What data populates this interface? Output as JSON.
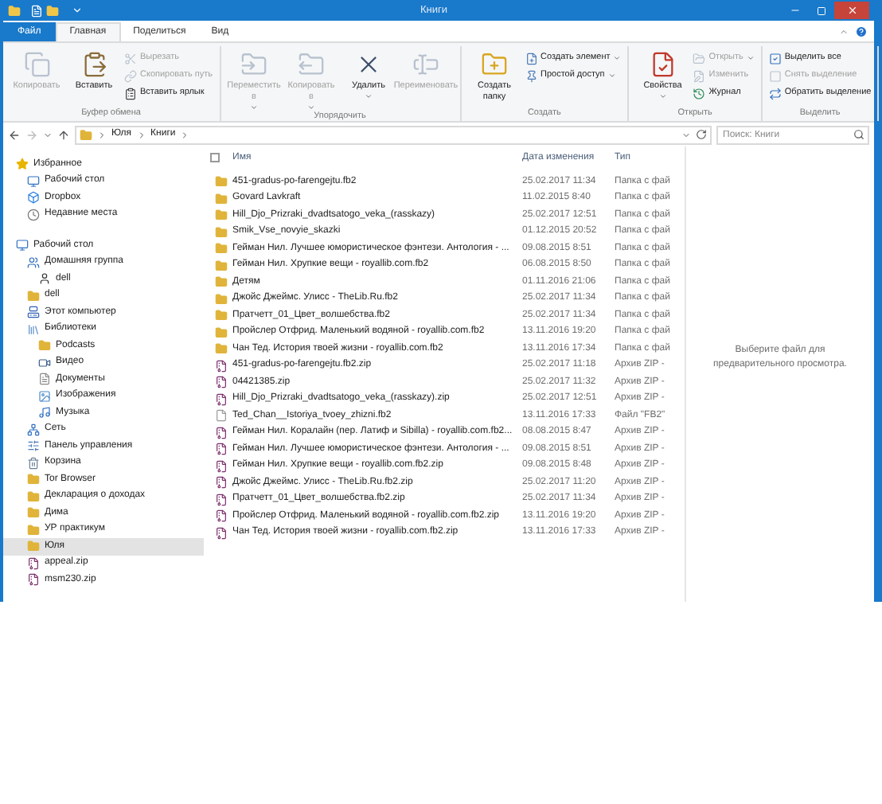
{
  "window": {
    "title": "Книги"
  },
  "tabs": [
    {
      "label": "Файл",
      "kind": "file",
      "selected": false
    },
    {
      "label": "Главная",
      "kind": "tab",
      "selected": true
    },
    {
      "label": "Поделиться",
      "kind": "tab",
      "selected": false
    },
    {
      "label": "Вид",
      "kind": "tab",
      "selected": false
    }
  ],
  "ribbon": [
    {
      "name": "Буфер обмена",
      "items": [
        {
          "label": "Копировать",
          "kind": "large",
          "disabled": true
        },
        {
          "label": "Вставить",
          "kind": "large",
          "disabled": false
        },
        {
          "label": "Вырезать",
          "kind": "small",
          "disabled": true
        },
        {
          "label": "Скопировать путь",
          "kind": "small",
          "disabled": true
        },
        {
          "label": "Вставить ярлык",
          "kind": "small",
          "disabled": false
        }
      ]
    },
    {
      "name": "Упорядочить",
      "items": [
        {
          "label": "Переместить в",
          "kind": "large",
          "disabled": true,
          "dropdown": true
        },
        {
          "label": "Копировать в",
          "kind": "large",
          "disabled": true,
          "dropdown": true
        },
        {
          "label": "Удалить",
          "kind": "large",
          "disabled": false,
          "dropdown": true
        },
        {
          "label": "Переименовать",
          "kind": "large",
          "disabled": true
        }
      ]
    },
    {
      "name": "Создать",
      "items": [
        {
          "label": "Создать папку",
          "kind": "large",
          "disabled": false
        },
        {
          "label": "Создать элемент",
          "kind": "small",
          "disabled": false,
          "dropdown": true
        },
        {
          "label": "Простой доступ",
          "kind": "small",
          "disabled": false,
          "dropdown": true
        }
      ]
    },
    {
      "name": "Открыть",
      "items": [
        {
          "label": "Свойства",
          "kind": "large",
          "disabled": false,
          "dropdown": true
        },
        {
          "label": "Открыть",
          "kind": "small",
          "disabled": true,
          "dropdown": true
        },
        {
          "label": "Изменить",
          "kind": "small",
          "disabled": true
        },
        {
          "label": "Журнал",
          "kind": "small",
          "disabled": false
        }
      ]
    },
    {
      "name": "Выделить",
      "items": [
        {
          "label": "Выделить все",
          "kind": "small",
          "disabled": false
        },
        {
          "label": "Снять выделение",
          "kind": "small",
          "disabled": true
        },
        {
          "label": "Обратить выделение",
          "kind": "small",
          "disabled": false
        }
      ]
    }
  ],
  "address": {
    "path": [
      "Юля",
      "Книги"
    ],
    "search_placeholder": "Поиск: Книги"
  },
  "sidebar": [
    {
      "items": [
        {
          "label": "Избранное",
          "selected": false,
          "children": [
            {
              "label": "Рабочий стол",
              "selected": false
            },
            {
              "label": "Dropbox",
              "selected": false
            },
            {
              "label": "Недавние места",
              "selected": false
            }
          ]
        }
      ]
    },
    {
      "items": [
        {
          "label": "Рабочий стол",
          "selected": false,
          "children": [
            {
              "label": "Домашняя группа",
              "selected": false,
              "children": [
                {
                  "label": "dell",
                  "selected": false
                }
              ]
            },
            {
              "label": "dell",
              "selected": false
            },
            {
              "label": "Этот компьютер",
              "selected": false
            },
            {
              "label": "Библиотеки",
              "selected": false,
              "children": [
                {
                  "label": "Podcasts",
                  "selected": false
                },
                {
                  "label": "Видео",
                  "selected": false
                },
                {
                  "label": "Документы",
                  "selected": false
                },
                {
                  "label": "Изображения",
                  "selected": false
                },
                {
                  "label": "Музыка",
                  "selected": false
                }
              ]
            },
            {
              "label": "Сеть",
              "selected": false
            },
            {
              "label": "Панель управления",
              "selected": false
            },
            {
              "label": "Корзина",
              "selected": false
            },
            {
              "label": "Tor Browser",
              "selected": false
            },
            {
              "label": "Декларация о доходах",
              "selected": false
            },
            {
              "label": "Дима",
              "selected": false
            },
            {
              "label": "УР практикум",
              "selected": false
            },
            {
              "label": "Юля",
              "selected": true
            },
            {
              "label": "appeal.zip",
              "selected": false
            },
            {
              "label": "msm230.zip",
              "selected": false
            }
          ]
        }
      ]
    }
  ],
  "columns": {
    "checked": false,
    "labels": [
      "Имя",
      "Дата изменения",
      "Тип"
    ]
  },
  "rows": [
    {
      "name": "451-gradus-po-farengejtu.fb2",
      "date": "25.02.2017 11:34",
      "type": "Папка с фай",
      "kind": "folder"
    },
    {
      "name": "Govard Lavkraft",
      "date": "11.02.2015 8:40",
      "type": "Папка с фай",
      "kind": "folder"
    },
    {
      "name": "Hill_Djo_Prizraki_dvadtsatogo_veka_(rasskazy)",
      "date": "25.02.2017 12:51",
      "type": "Папка с фай",
      "kind": "folder"
    },
    {
      "name": "Smik_Vse_novyie_skazki",
      "date": "01.12.2015 20:52",
      "type": "Папка с фай",
      "kind": "folder"
    },
    {
      "name": "Гейман Нил. Лучшее юмористическое фэнтези. Антология - ...",
      "date": "09.08.2015 8:51",
      "type": "Папка с фай",
      "kind": "folder"
    },
    {
      "name": "Гейман Нил. Хрупкие вещи - royallib.com.fb2",
      "date": "06.08.2015 8:50",
      "type": "Папка с фай",
      "kind": "folder"
    },
    {
      "name": "Детям",
      "date": "01.11.2016 21:06",
      "type": "Папка с фай",
      "kind": "folder"
    },
    {
      "name": "Джойс Джеймс. Улисс - TheLib.Ru.fb2",
      "date": "25.02.2017 11:34",
      "type": "Папка с фай",
      "kind": "folder"
    },
    {
      "name": "Пратчетт_01_Цвет_волшебства.fb2",
      "date": "25.02.2017 11:34",
      "type": "Папка с фай",
      "kind": "folder"
    },
    {
      "name": "Пройслер Отфрид. Маленький водяной - royallib.com.fb2",
      "date": "13.11.2016 19:20",
      "type": "Папка с фай",
      "kind": "folder"
    },
    {
      "name": "Чан Тед. История твоей жизни - royallib.com.fb2",
      "date": "13.11.2016 17:34",
      "type": "Папка с фай",
      "kind": "folder"
    },
    {
      "name": "451-gradus-po-farengejtu.fb2.zip",
      "date": "25.02.2017 11:18",
      "type": "Архив ZIP -",
      "kind": "zip"
    },
    {
      "name": "04421385.zip",
      "date": "25.02.2017 11:32",
      "type": "Архив ZIP -",
      "kind": "zip"
    },
    {
      "name": "Hill_Djo_Prizraki_dvadtsatogo_veka_(rasskazy).zip",
      "date": "25.02.2017 12:51",
      "type": "Архив ZIP -",
      "kind": "zip"
    },
    {
      "name": "Ted_Chan__Istoriya_tvoey_zhizni.fb2",
      "date": "13.11.2016 17:33",
      "type": "Файл \"FB2\"",
      "kind": "file"
    },
    {
      "name": "Гейман Нил. Коралайн (пер. Латиф и Sibilla) - royallib.com.fb2...",
      "date": "08.08.2015 8:47",
      "type": "Архив ZIP -",
      "kind": "zip"
    },
    {
      "name": "Гейман Нил. Лучшее юмористическое фэнтези. Антология - ...",
      "date": "09.08.2015 8:51",
      "type": "Архив ZIP -",
      "kind": "zip"
    },
    {
      "name": "Гейман Нил. Хрупкие вещи - royallib.com.fb2.zip",
      "date": "09.08.2015 8:48",
      "type": "Архив ZIP -",
      "kind": "zip"
    },
    {
      "name": "Джойс Джеймс. Улисс - TheLib.Ru.fb2.zip",
      "date": "25.02.2017 11:20",
      "type": "Архив ZIP -",
      "kind": "zip"
    },
    {
      "name": "Пратчетт_01_Цвет_волшебства.fb2.zip",
      "date": "25.02.2017 11:34",
      "type": "Архив ZIP -",
      "kind": "zip"
    },
    {
      "name": "Пройслер Отфрид. Маленький водяной - royallib.com.fb2.zip",
      "date": "13.11.2016 19:20",
      "type": "Архив ZIP -",
      "kind": "zip"
    },
    {
      "name": "Чан Тед. История твоей жизни - royallib.com.fb2.zip",
      "date": "13.11.2016 17:33",
      "type": "Архив ZIP -",
      "kind": "zip"
    }
  ],
  "preview": {
    "message": "Выберите файл для предварительного просмотра."
  }
}
